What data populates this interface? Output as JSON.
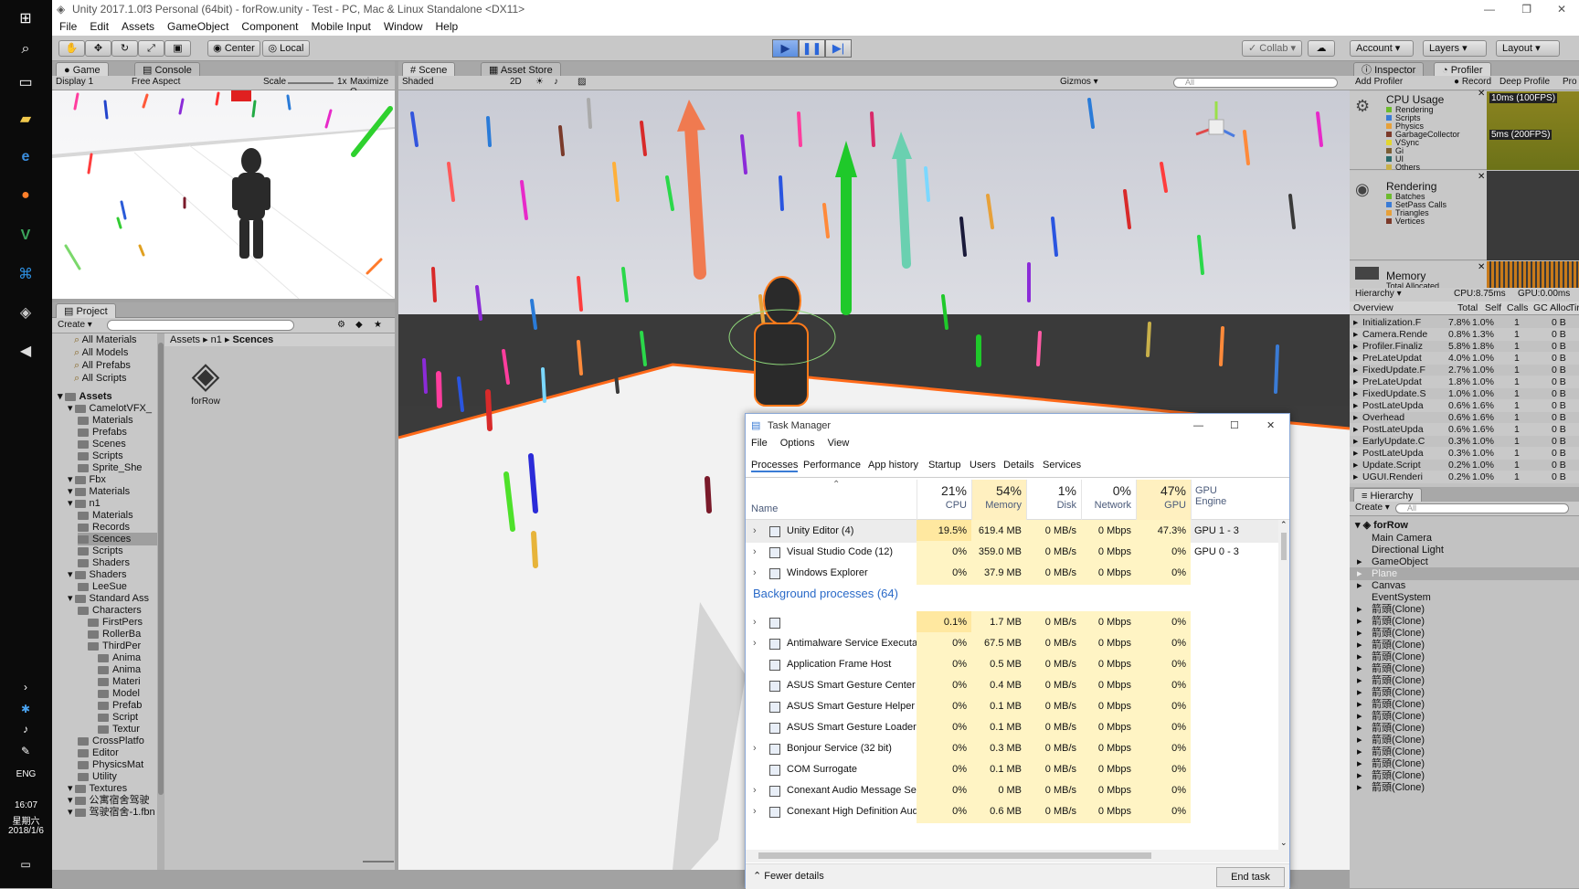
{
  "window": {
    "title": "Unity 2017.1.0f3 Personal (64bit) - forRow.unity - Test - PC, Mac & Linux Standalone <DX11>"
  },
  "menu": [
    "File",
    "Edit",
    "Assets",
    "GameObject",
    "Component",
    "Mobile Input",
    "Window",
    "Help"
  ],
  "toolbar": {
    "center": "Center",
    "local": "Local",
    "collab": "Collab",
    "account": "Account",
    "layers": "Layers",
    "layout": "Layout"
  },
  "game_panel": {
    "tab_game": "Game",
    "tab_console": "Console",
    "display": "Display 1",
    "aspect": "Free Aspect",
    "scale_label": "Scale",
    "scale_value": "1x",
    "maximize": "Maximize O"
  },
  "scene_panel": {
    "tab_scene": "Scene",
    "tab_asset_store": "Asset Store",
    "shading": "Shaded",
    "mode_2d": "2D",
    "gizmos": "Gizmos",
    "search_placeholder": "All"
  },
  "project": {
    "tab": "Project",
    "create": "Create",
    "favorites": [
      "All Materials",
      "All Models",
      "All Prefabs",
      "All Scripts"
    ],
    "breadcrumb": [
      "Assets",
      "n1",
      "Scences"
    ],
    "asset_name": "forRow",
    "tree": [
      {
        "label": "Assets",
        "level": 0,
        "bold": true
      },
      {
        "label": "CamelotVFX_",
        "level": 1
      },
      {
        "label": "Materials",
        "level": 2
      },
      {
        "label": "Prefabs",
        "level": 2
      },
      {
        "label": "Scenes",
        "level": 2
      },
      {
        "label": "Scripts",
        "level": 2
      },
      {
        "label": "Sprite_She",
        "level": 2
      },
      {
        "label": "Fbx",
        "level": 1
      },
      {
        "label": "Materials",
        "level": 1
      },
      {
        "label": "n1",
        "level": 1
      },
      {
        "label": "Materials",
        "level": 2
      },
      {
        "label": "Records",
        "level": 2
      },
      {
        "label": "Scences",
        "level": 2,
        "selected": true
      },
      {
        "label": "Scripts",
        "level": 2
      },
      {
        "label": "Shaders",
        "level": 2
      },
      {
        "label": "Shaders",
        "level": 1
      },
      {
        "label": "LeeSue",
        "level": 2
      },
      {
        "label": "Standard Ass",
        "level": 1
      },
      {
        "label": "Characters",
        "level": 2
      },
      {
        "label": "FirstPers",
        "level": 3
      },
      {
        "label": "RollerBa",
        "level": 3
      },
      {
        "label": "ThirdPer",
        "level": 3
      },
      {
        "label": "Anima",
        "level": 4
      },
      {
        "label": "Anima",
        "level": 4
      },
      {
        "label": "Materi",
        "level": 4
      },
      {
        "label": "Model",
        "level": 4
      },
      {
        "label": "Prefab",
        "level": 4
      },
      {
        "label": "Script",
        "level": 4
      },
      {
        "label": "Textur",
        "level": 4
      },
      {
        "label": "CrossPlatfo",
        "level": 2
      },
      {
        "label": "Editor",
        "level": 2
      },
      {
        "label": "PhysicsMat",
        "level": 2
      },
      {
        "label": "Utility",
        "level": 2
      },
      {
        "label": "Textures",
        "level": 1
      },
      {
        "label": "公寓宿舍驾驶",
        "level": 1
      },
      {
        "label": "驾驶宿舍-1.fbn",
        "level": 1
      }
    ]
  },
  "inspector": {
    "tab_inspector": "Inspector",
    "tab_profiler": "Profiler",
    "add_profiler": "Add Profiler",
    "record": "Record",
    "deep_profile": "Deep Profile",
    "pro": "Pro"
  },
  "profiler": {
    "cpu_title": "CPU Usage",
    "cpu_items": [
      "Rendering",
      "Scripts",
      "Physics",
      "GarbageCollector",
      "VSync",
      "Gi",
      "UI",
      "Others"
    ],
    "cpu_colors": [
      "#6cbb2d",
      "#3a7bd5",
      "#e7a13a",
      "#7c3a2a",
      "#e2d630",
      "#7c5e33",
      "#2a6a6a",
      "#c8b04a"
    ],
    "graph_label_1": "10ms (100FPS)",
    "graph_label_2": "5ms (200FPS)",
    "rendering_title": "Rendering",
    "rendering_items": [
      "Batches",
      "SetPass Calls",
      "Triangles",
      "Vertices"
    ],
    "memory_title": "Memory",
    "memory_sub": "Total Allocated",
    "hierarchy_mode": "Hierarchy",
    "cpu_time": "CPU:8.75ms",
    "gpu_time": "GPU:0.00ms",
    "columns": [
      "Overview",
      "Total",
      "Self",
      "Calls",
      "GC Alloc",
      "Tir"
    ],
    "rows": [
      {
        "name": "Initialization.F",
        "total": "7.8%",
        "self": "1.0%",
        "calls": "1",
        "gc": "0 B"
      },
      {
        "name": "Camera.Rende",
        "total": "0.8%",
        "self": "1.3%",
        "calls": "1",
        "gc": "0 B"
      },
      {
        "name": "Profiler.Finaliz",
        "total": "5.8%",
        "self": "1.8%",
        "calls": "1",
        "gc": "0 B"
      },
      {
        "name": "PreLateUpdat",
        "total": "4.0%",
        "self": "1.0%",
        "calls": "1",
        "gc": "0 B"
      },
      {
        "name": "FixedUpdate.F",
        "total": "2.7%",
        "self": "1.0%",
        "calls": "1",
        "gc": "0 B"
      },
      {
        "name": "PreLateUpdat",
        "total": "1.8%",
        "self": "1.0%",
        "calls": "1",
        "gc": "0 B"
      },
      {
        "name": "FixedUpdate.S",
        "total": "1.0%",
        "self": "1.0%",
        "calls": "1",
        "gc": "0 B"
      },
      {
        "name": "PostLateUpda",
        "total": "0.6%",
        "self": "1.6%",
        "calls": "1",
        "gc": "0 B"
      },
      {
        "name": "Overhead",
        "total": "0.6%",
        "self": "1.6%",
        "calls": "1",
        "gc": "0 B"
      },
      {
        "name": "PostLateUpda",
        "total": "0.6%",
        "self": "1.6%",
        "calls": "1",
        "gc": "0 B"
      },
      {
        "name": "EarlyUpdate.C",
        "total": "0.3%",
        "self": "1.0%",
        "calls": "1",
        "gc": "0 B"
      },
      {
        "name": "PostLateUpda",
        "total": "0.3%",
        "self": "1.0%",
        "calls": "1",
        "gc": "0 B"
      },
      {
        "name": "Update.Script",
        "total": "0.2%",
        "self": "1.0%",
        "calls": "1",
        "gc": "0 B"
      },
      {
        "name": "UGUI.Renderi",
        "total": "0.2%",
        "self": "1.0%",
        "calls": "1",
        "gc": "0 B"
      }
    ]
  },
  "hierarchy": {
    "tab": "Hierarchy",
    "create": "Create",
    "search_placeholder": "All",
    "scene": "forRow",
    "items": [
      "Main Camera",
      "Directional Light",
      "GameObject",
      "Plane",
      "Canvas",
      "EventSystem",
      "箭頭(Clone)",
      "箭頭(Clone)",
      "箭頭(Clone)",
      "箭頭(Clone)",
      "箭頭(Clone)",
      "箭頭(Clone)",
      "箭頭(Clone)",
      "箭頭(Clone)",
      "箭頭(Clone)",
      "箭頭(Clone)",
      "箭頭(Clone)",
      "箭頭(Clone)",
      "箭頭(Clone)",
      "箭頭(Clone)",
      "箭頭(Clone)",
      "箭頭(Clone)"
    ]
  },
  "taskbar": {
    "lang": "ENG",
    "time": "16:07",
    "day": "星期六",
    "date": "2018/1/6"
  },
  "task_manager": {
    "title": "Task Manager",
    "menu": [
      "File",
      "Options",
      "View"
    ],
    "tabs": [
      "Processes",
      "Performance",
      "App history",
      "Startup",
      "Users",
      "Details",
      "Services"
    ],
    "col_name": "Name",
    "columns": [
      {
        "pct": "21%",
        "label": "CPU"
      },
      {
        "pct": "54%",
        "label": "Memory"
      },
      {
        "pct": "1%",
        "label": "Disk"
      },
      {
        "pct": "0%",
        "label": "Network"
      },
      {
        "pct": "47%",
        "label": "GPU"
      },
      {
        "pct": "",
        "label": "GPU Engine"
      }
    ],
    "apps": [
      {
        "name": "Unity Editor (4)",
        "cpu": "19.5%",
        "mem": "619.4 MB",
        "disk": "0 MB/s",
        "net": "0 Mbps",
        "gpu": "47.3%",
        "engine": "GPU 1 - 3"
      },
      {
        "name": "Visual Studio Code (12)",
        "cpu": "0%",
        "mem": "359.0 MB",
        "disk": "0 MB/s",
        "net": "0 Mbps",
        "gpu": "0%",
        "engine": "GPU 0 - 3"
      },
      {
        "name": "Windows Explorer",
        "cpu": "0%",
        "mem": "37.9 MB",
        "disk": "0 MB/s",
        "net": "0 Mbps",
        "gpu": "0%",
        "engine": ""
      }
    ],
    "bg_header": "Background processes (64)",
    "bg": [
      {
        "name": "",
        "cpu": "0.1%",
        "mem": "1.7 MB",
        "disk": "0 MB/s",
        "net": "0 Mbps",
        "gpu": "0%"
      },
      {
        "name": "Antimalware Service Executable",
        "cpu": "0%",
        "mem": "67.5 MB",
        "disk": "0 MB/s",
        "net": "0 Mbps",
        "gpu": "0%"
      },
      {
        "name": "Application Frame Host",
        "cpu": "0%",
        "mem": "0.5 MB",
        "disk": "0 MB/s",
        "net": "0 Mbps",
        "gpu": "0%"
      },
      {
        "name": "ASUS Smart Gesture Center",
        "cpu": "0%",
        "mem": "0.4 MB",
        "disk": "0 MB/s",
        "net": "0 Mbps",
        "gpu": "0%"
      },
      {
        "name": "ASUS Smart Gesture Helper",
        "cpu": "0%",
        "mem": "0.1 MB",
        "disk": "0 MB/s",
        "net": "0 Mbps",
        "gpu": "0%"
      },
      {
        "name": "ASUS Smart Gesture Loader",
        "cpu": "0%",
        "mem": "0.1 MB",
        "disk": "0 MB/s",
        "net": "0 Mbps",
        "gpu": "0%"
      },
      {
        "name": "Bonjour Service (32 bit)",
        "cpu": "0%",
        "mem": "0.3 MB",
        "disk": "0 MB/s",
        "net": "0 Mbps",
        "gpu": "0%"
      },
      {
        "name": "COM Surrogate",
        "cpu": "0%",
        "mem": "0.1 MB",
        "disk": "0 MB/s",
        "net": "0 Mbps",
        "gpu": "0%"
      },
      {
        "name": "Conexant Audio Message Servi...",
        "cpu": "0%",
        "mem": "0 MB",
        "disk": "0 MB/s",
        "net": "0 Mbps",
        "gpu": "0%"
      },
      {
        "name": "Conexant High Definition Audi...",
        "cpu": "0%",
        "mem": "0.6 MB",
        "disk": "0 MB/s",
        "net": "0 Mbps",
        "gpu": "0%"
      }
    ],
    "fewer": "Fewer details",
    "end_task": "End task"
  }
}
